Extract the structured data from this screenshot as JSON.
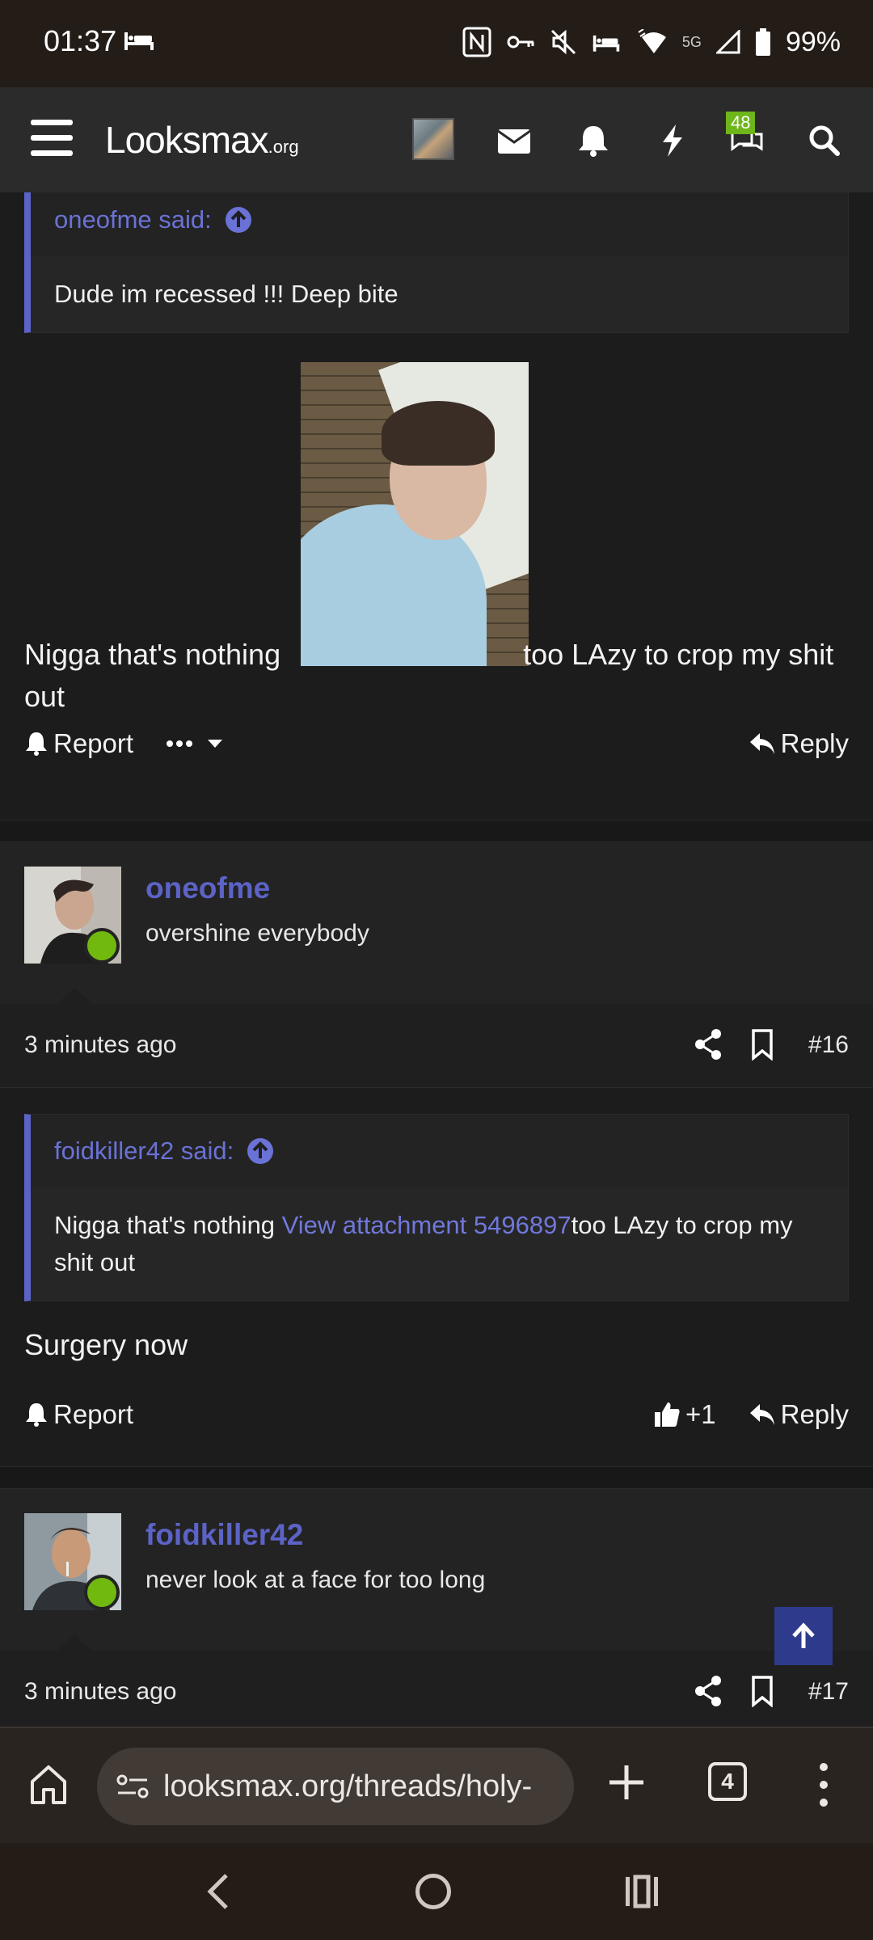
{
  "status_bar": {
    "time": "01:37",
    "network": "5G",
    "battery": "99%"
  },
  "header": {
    "logo_main": "Looksmax",
    "logo_suffix": ".org",
    "chat_badge": "48",
    "icons": [
      "menu-icon",
      "avatar",
      "mail-icon",
      "bell-icon",
      "lightning-icon",
      "chat-icon",
      "search-icon"
    ]
  },
  "post15": {
    "quote_author": "oneofme said:",
    "quote_text": "Dude im recessed !!! Deep bite",
    "text_before": "Nigga that's nothing ",
    "text_after": "too LAzy to crop my shit out",
    "report": "Report",
    "reply": "Reply"
  },
  "post16": {
    "username": "oneofme",
    "user_title": "overshine everybody",
    "time": "3 minutes ago",
    "post_number": "#16",
    "quote_author": "foidkiller42 said:",
    "quote_text_before": "Nigga that's nothing ",
    "quote_link": "View attachment 5496897",
    "quote_text_after": "too LAzy to crop my shit out",
    "text": "Surgery now",
    "report": "Report",
    "like_count": "+1",
    "reply": "Reply"
  },
  "post17": {
    "username": "foidkiller42",
    "user_title": "never look at a face for too long",
    "time": "3 minutes ago",
    "post_number": "#17"
  },
  "browser": {
    "url": "looksmax.org/threads/holy-",
    "tab_count": "4"
  },
  "colors": {
    "accent": "#5c63c6",
    "online": "#71b80f",
    "badge": "#6fb61a"
  }
}
